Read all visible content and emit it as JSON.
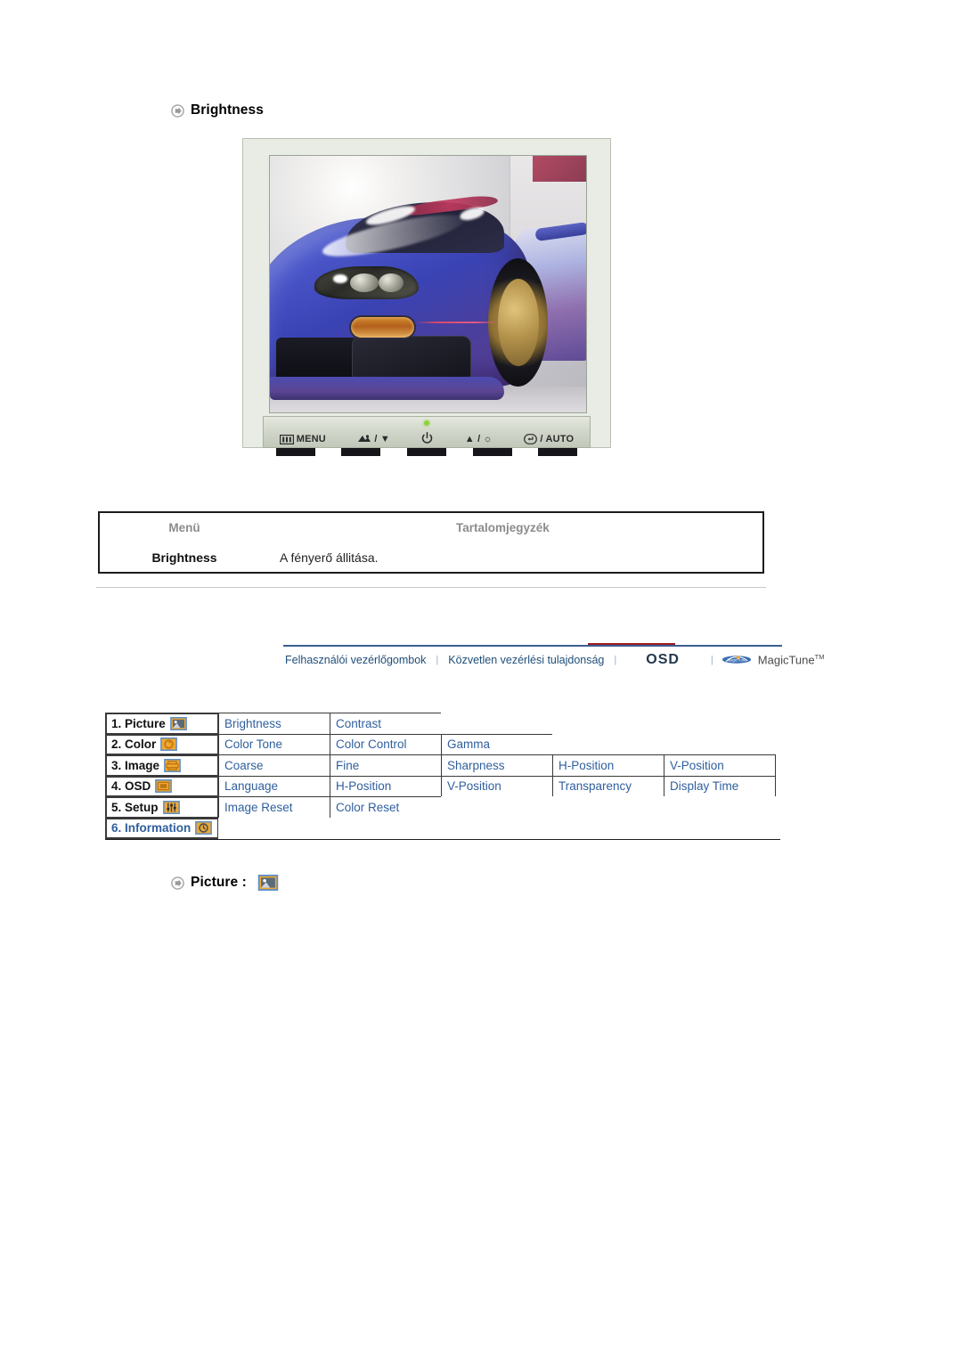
{
  "page": {
    "section_heading": {
      "label": "Brightness",
      "bullet_icon": "circle-arrow-bullet-icon"
    }
  },
  "monitor": {
    "panel_buttons": [
      {
        "icon": "menu-icon",
        "label": "MENU"
      },
      {
        "icon": "source-icon",
        "label": "/ ▼"
      },
      {
        "icon": "power-icon",
        "label": "⏻"
      },
      {
        "icon": "brightness-icon",
        "label": "▲ / ☼"
      },
      {
        "icon": "enter-icon",
        "label": "/ AUTO"
      }
    ],
    "led_color": "#8fd13a",
    "bezel_color": "#e8ece4"
  },
  "menu_table": {
    "headers": {
      "menu": "Menü",
      "contents": "Tartalomjegyzék"
    },
    "rows": [
      {
        "menu": "Brightness",
        "contents": "A fényerő állitása."
      }
    ]
  },
  "navbar": {
    "items": [
      {
        "label": "Felhasználói vezérlőgombok",
        "active": false
      },
      {
        "label": "Közvetlen vezérlési tulajdonság",
        "active": false
      },
      {
        "label": "OSD",
        "active": true
      },
      {
        "label": "MagicTune",
        "active": false,
        "superscript": "TM"
      }
    ],
    "separator": "|",
    "active_color": "#9e1b1e",
    "link_color": "#1f4e79"
  },
  "osd_table": {
    "rows": [
      {
        "label": "1. Picture",
        "icon": "picture-icon",
        "label_blue": false,
        "items": [
          "Brightness",
          "Contrast"
        ]
      },
      {
        "label": "2. Color",
        "icon": "color-icon",
        "label_blue": false,
        "items": [
          "Color Tone",
          "Color Control",
          "Gamma"
        ]
      },
      {
        "label": "3. Image",
        "icon": "image-icon",
        "label_blue": false,
        "items": [
          "Coarse",
          "Fine",
          "Sharpness",
          "H-Position",
          "V-Position"
        ]
      },
      {
        "label": "4. OSD",
        "icon": "osd-icon",
        "label_blue": false,
        "items": [
          "Language",
          "H-Position",
          "V-Position",
          "Transparency",
          "Display Time"
        ]
      },
      {
        "label": "5. Setup",
        "icon": "setup-icon",
        "label_blue": false,
        "items": [
          "Image Reset",
          "Color Reset"
        ]
      },
      {
        "label": "6. Information",
        "icon": "information-icon",
        "label_blue": true,
        "items": []
      }
    ],
    "item_color": "#2f5f9e",
    "icon_color": "#f2a72e"
  },
  "picture_heading": {
    "label": "Picture :",
    "bullet_icon": "circle-arrow-bullet-icon",
    "icon": "picture-icon"
  }
}
